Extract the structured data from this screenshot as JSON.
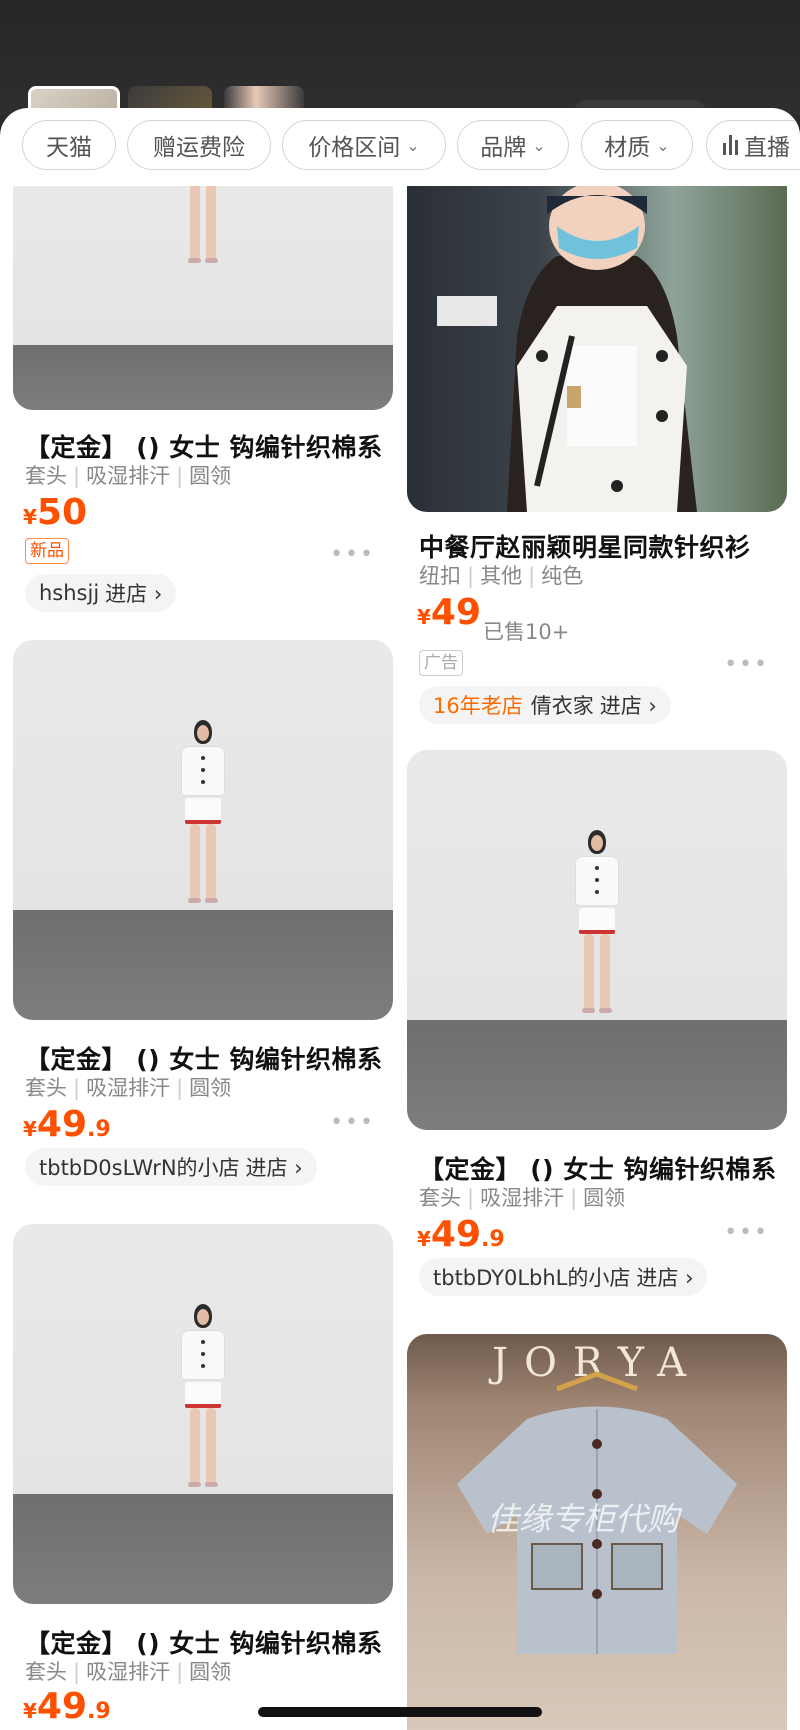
{
  "filters": [
    {
      "label": "天猫",
      "chevron": false
    },
    {
      "label": "赠运费险",
      "chevron": false
    },
    {
      "label": "价格区间",
      "chevron": true
    },
    {
      "label": "品牌",
      "chevron": true
    },
    {
      "label": "材质",
      "chevron": true
    },
    {
      "label": "直播",
      "chevron": false,
      "icon": "bar-chart-icon"
    }
  ],
  "chevron": "⌄",
  "more_dots": "•••",
  "products": {
    "p1": {
      "title": "【定金】 () 女士 钩编针织棉系",
      "tags": [
        "套头",
        "吸湿排汗",
        "圆领"
      ],
      "yen": "¥",
      "price_int": "50",
      "price_dec": "",
      "badge": "新品",
      "shop": "hshsjj",
      "enter": "进店 ›"
    },
    "p2": {
      "title": "中餐厅赵丽颖明星同款针织衫",
      "tags": [
        "纽扣",
        "其他",
        "纯色"
      ],
      "yen": "¥",
      "price_int": "49",
      "price_dec": "",
      "sold": "已售10+",
      "badge": "广告",
      "shop_prefix": "16年老店",
      "shop": "倩衣家",
      "enter": "进店 ›"
    },
    "p3": {
      "title": "【定金】 () 女士 钩编针织棉系",
      "tags": [
        "套头",
        "吸湿排汗",
        "圆领"
      ],
      "yen": "¥",
      "price_int": "49",
      "price_dec": ".9",
      "shop": "tbtbD0sLWrN的小店",
      "enter": "进店 ›"
    },
    "p4": {
      "title": "【定金】 () 女士 钩编针织棉系",
      "tags": [
        "套头",
        "吸湿排汗",
        "圆领"
      ],
      "yen": "¥",
      "price_int": "49",
      "price_dec": ".9",
      "shop": "tbtbDY0LbhL的小店",
      "enter": "进店 ›"
    },
    "p5": {
      "title": "【定金】 () 女士 钩编针织棉系",
      "tags": [
        "套头",
        "吸湿排汗",
        "圆领"
      ],
      "yen": "¥",
      "price_int": "49",
      "price_dec": ".9"
    },
    "p6": {
      "brand_sign": "JORYA",
      "watermark": "佳缘专柜代购"
    }
  },
  "colors": {
    "price": "#ff5000",
    "old_shop": "#ff6a00"
  }
}
